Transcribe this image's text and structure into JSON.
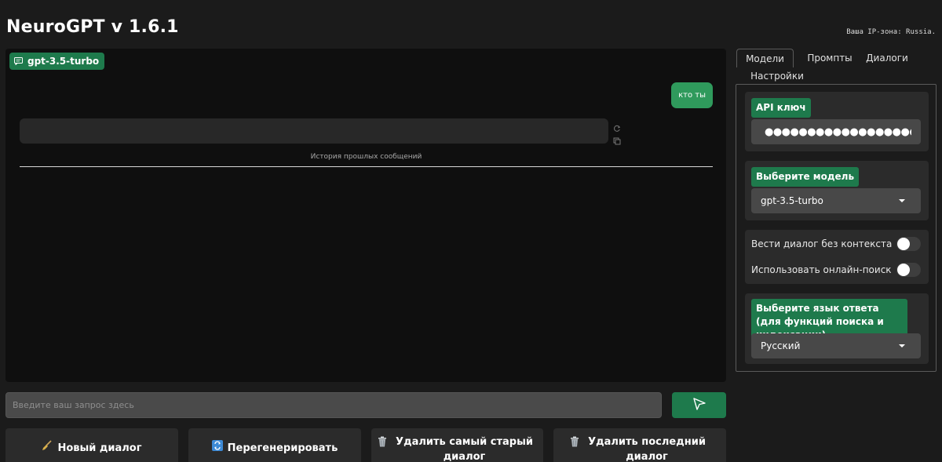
{
  "header": {
    "title": "NeuroGPT v 1.6.1",
    "ip_zone": "Ваша IP-зона: Russia."
  },
  "chat": {
    "model_badge": "gpt-3.5-turbo",
    "model_badge_icon": "chat-bubble-icon",
    "user_message": "кто ты",
    "history_label": "История прошлых сообщений",
    "message_tools": [
      "refresh-icon",
      "copy-icon"
    ]
  },
  "input": {
    "placeholder": "Введите ваш запрос здесь",
    "value": "",
    "send_icon": "send-arrow-icon"
  },
  "actions": [
    {
      "icon": "broom-icon",
      "label": "Новый диалог"
    },
    {
      "icon": "refresh-arrows-icon",
      "label": "Перегенерировать"
    },
    {
      "icon": "trash-icon",
      "label": "Удалить самый старый диалог"
    },
    {
      "icon": "trash-icon",
      "label": "Удалить последний диалог"
    }
  ],
  "tabs": [
    {
      "label": "Модели",
      "active": true
    },
    {
      "label": "Промпты",
      "active": false
    },
    {
      "label": "Диалоги",
      "active": false
    },
    {
      "label": "Настройки",
      "active": false
    }
  ],
  "settings": {
    "api_key_label": "API ключ",
    "api_key_value": "●●●●●●●●●●●●●●●●●●●●●●●●●●●●",
    "model_label": "Выберите модель",
    "model_value": "gpt-3.5-turbo",
    "toggles": [
      {
        "label": "Вести диалог без контекста",
        "on": false
      },
      {
        "label": "Использовать онлайн-поиск",
        "on": false
      }
    ],
    "language_label": "Выберите язык ответа (для функций поиска и индексации)",
    "language_value": "Русский"
  },
  "colors": {
    "accent_green": "#1e7a4c",
    "user_bubble": "#2f9a5c",
    "background": "#1b1b1b",
    "chat_background": "#0f0f0f",
    "panel_card": "#2b2b2b"
  }
}
